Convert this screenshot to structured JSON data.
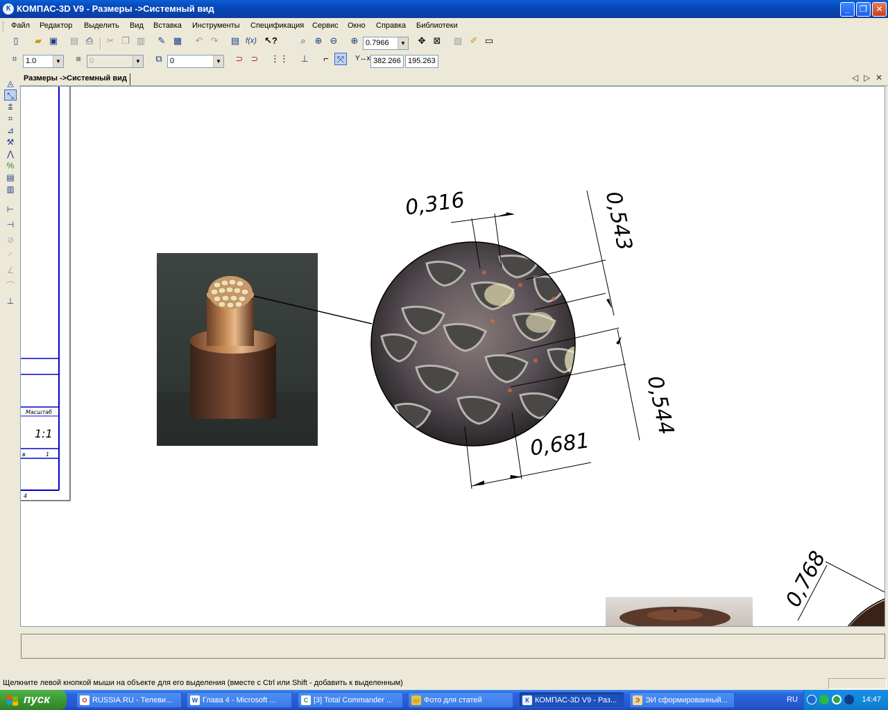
{
  "window": {
    "title": "КОМПАС-3D V9 - Размеры ->Системный вид",
    "app_icon_letter": "К",
    "minimize": "_",
    "maximize": "❐",
    "close": "✕"
  },
  "menu": [
    "Файл",
    "Редактор",
    "Выделить",
    "Вид",
    "Вставка",
    "Инструменты",
    "Спецификация",
    "Сервис",
    "Окно",
    "Справка",
    "Библиотеки"
  ],
  "toolbar1": {
    "zoom_value": "0.7966"
  },
  "toolbar2": {
    "step_value": "1.0",
    "style_value": "0",
    "layer_value": "0",
    "coord_label": "Y↔x",
    "coord_x": "382.266",
    "coord_y": "195.263"
  },
  "doc_tab": {
    "label": "Размеры ->Системный вид",
    "prev": "◁",
    "next": "▷",
    "close": "✕"
  },
  "drawing": {
    "title_block_scale_label": "Масштаб",
    "title_block_scale": "1:1",
    "title_block_sheet_prefix": "в",
    "title_block_sheet": "1",
    "title_block_corner": "4",
    "dimensions": [
      "0,316",
      "0,543",
      "0,544",
      "0,681",
      "0,768"
    ]
  },
  "status_message": "Щелкните левой кнопкой мыши на объекте для его выделения (вместе с Ctrl или Shift - добавить к выделенным)",
  "taskbar": {
    "start_label": "пуск",
    "tasks": [
      {
        "label": "RUSSIA.RU - Телеви...",
        "icon": "O",
        "color": "#d01818"
      },
      {
        "label": "Глава 4 - Microsoft ...",
        "icon": "W",
        "color": "#1d4fb0"
      },
      {
        "label": "[3] Total Commander ...",
        "icon": "C",
        "color": "#2a8a4a"
      },
      {
        "label": "Фото для статей",
        "icon": "▭",
        "color": "#e8c040"
      },
      {
        "label": "КОМПАС-3D V9 - Раз...",
        "icon": "К",
        "color": "#1a4fb8"
      },
      {
        "label": "ЭИ сформированный...",
        "icon": "Э",
        "color": "#c08030"
      }
    ],
    "active_task": 4,
    "language": "RU",
    "clock": "14:47"
  },
  "colors": {
    "titlebar": "#0a47b8",
    "frame_blue": "#0000c8",
    "taskbar": "#2657d0",
    "start_green": "#3c9a34"
  }
}
